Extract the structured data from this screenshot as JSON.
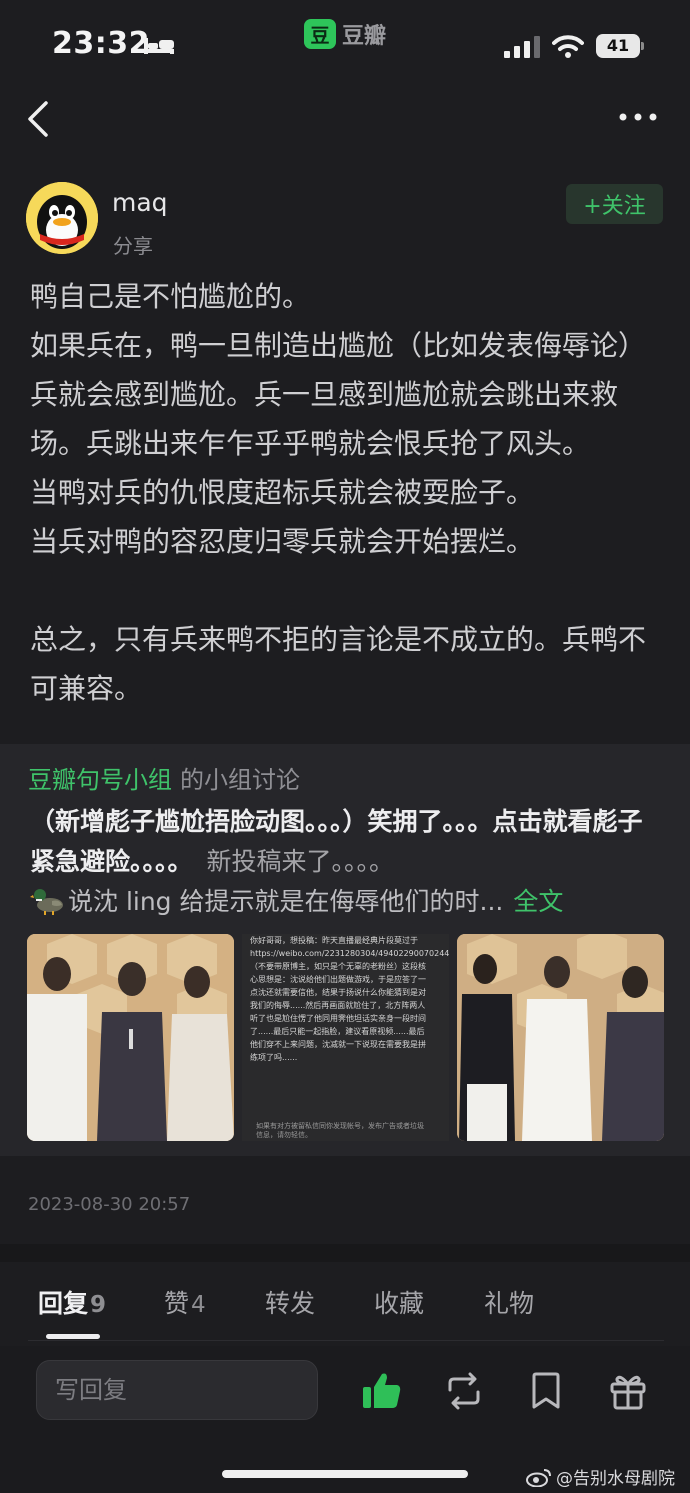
{
  "status_bar": {
    "time": "23:32",
    "app_name": "豆瓣",
    "app_logo_char": "豆",
    "battery": "41"
  },
  "post": {
    "author": "maq",
    "action": "分享",
    "follow_label": "+关注",
    "paragraphs": [
      "鸭自己是不怕尴尬的。",
      "如果兵在，鸭一旦制造出尴尬（比如发表侮辱论）兵就会感到尴尬。兵一旦感到尴尬就会跳出来救场。兵跳出来乍乍乎乎鸭就会恨兵抢了风头。",
      "当鸭对兵的仇恨度超标兵就会被耍脸子。",
      "当兵对鸭的容忍度归零兵就会开始摆烂。",
      "",
      "总之，只有兵来鸭不拒的言论是不成立的。兵鸭不可兼容。"
    ],
    "date": "2023-08-30 20:57"
  },
  "group_card": {
    "group_name": "豆瓣句号小组",
    "group_suffix": "的小组讨论",
    "title": "（新增彪子尴尬捂脸动图。。。）笑拥了。。。点击就看彪子紧急避险。。。。",
    "title_tag": "新投稿来了。。。。",
    "excerpt": "说沈 ling 给提示就是在侮辱他们的时...",
    "full_text_link": "全文",
    "screenshot_text": "你好哥哥，想投稿：昨天直播最经典片段莫过于https://weibo.com/2231280304/4940229007024490（不要带原博主，如只是个无辜的老粉丝）这段核心思想是：沈说给他们出题做游戏，于是应答了一点沈还就需要信他，结果于扬说什么你能猜到是对我们的侮辱......然后再画面就尬住了，北方阵两人听了也是尬住愣了他同用霁他坦话实亲身一段时间了......最后只能一起指脸，建议看原视频......最后他们穿不上来问题，沈减就一下说现在需要我是拼练项了吗......",
    "screenshot_footer": "如果有对方被留私信同你发现帐号，发布广告或者垃圾信息，请勿轻信。"
  },
  "tabs": [
    {
      "label": "回复",
      "count": "9",
      "active": true
    },
    {
      "label": "赞",
      "count": "4",
      "active": false
    },
    {
      "label": "转发",
      "count": "",
      "active": false
    },
    {
      "label": "收藏",
      "count": "",
      "active": false
    },
    {
      "label": "礼物",
      "count": "",
      "active": false
    }
  ],
  "bottom_bar": {
    "reply_placeholder": "写回复"
  },
  "watermark": "@告别水母剧院",
  "colors": {
    "accent_green": "#3fc36a",
    "background": "#1d1d20",
    "card": "#26262a"
  },
  "icons": [
    "bed-icon",
    "signal-icon",
    "wifi-icon",
    "back-icon",
    "more-icon",
    "duck-icon",
    "thumbs-up-icon",
    "repost-icon",
    "bookmark-icon",
    "gift-icon",
    "weibo-icon"
  ]
}
